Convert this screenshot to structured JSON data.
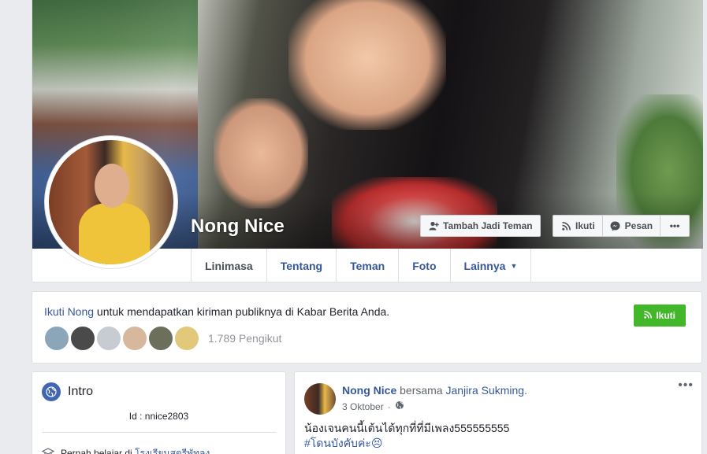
{
  "profile": {
    "name": "Nong Nice"
  },
  "actions": {
    "add_friend": "Tambah Jadi Teman",
    "follow": "Ikuti",
    "message": "Pesan",
    "more": "•••"
  },
  "tabs": [
    {
      "label": "Linimasa",
      "active": true
    },
    {
      "label": "Tentang"
    },
    {
      "label": "Teman"
    },
    {
      "label": "Foto"
    },
    {
      "label": "Lainnya"
    }
  ],
  "follow_card": {
    "link": "Ikuti Nong",
    "text": " untuk mendapatkan kiriman publiknya di Kabar Berita Anda.",
    "button": "Ikuti",
    "followers_count": "1.789 Pengikut",
    "follower_colors": [
      "#8aa6b8",
      "#4a4a4a",
      "#c7ccd3",
      "#d8b89c",
      "#6b6f5c",
      "#e2c87a"
    ]
  },
  "intro": {
    "title": "Intro",
    "id_line": "Id : nnice2803",
    "school_prefix": "Pernah belajar di ",
    "school_name": "โรงเรียนสตรีพัทลุง"
  },
  "post": {
    "author": "Nong Nice",
    "with_text": " bersama ",
    "tagged": "Janjira Sukming",
    "period": ".",
    "date": "3 Oktober",
    "dot": "·",
    "line1": "น้องเจนคนนี้เต้นได้ทุกที่ที่มีเพลง555555555",
    "line2": "#โดนบังคับค่ะ😣",
    "menu": "•••"
  },
  "colors": {
    "link": "#365899",
    "follow_green": "#42b72a",
    "page_bg": "#e9ebee"
  }
}
